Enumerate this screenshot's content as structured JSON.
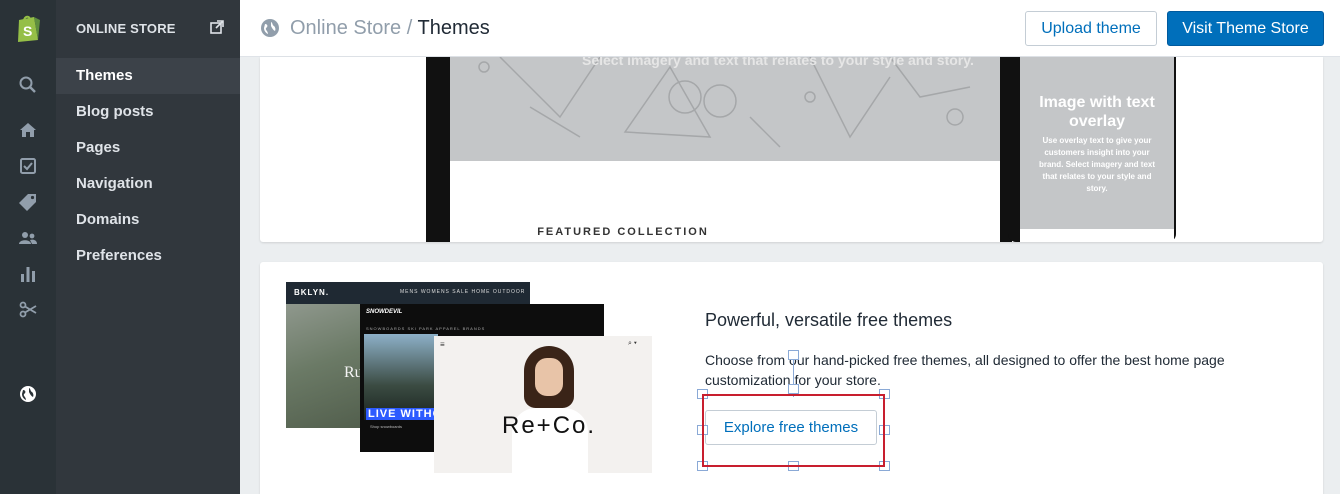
{
  "sidebar": {
    "heading": "ONLINE STORE",
    "items": [
      {
        "label": "Themes",
        "active": true
      },
      {
        "label": "Blog posts",
        "active": false
      },
      {
        "label": "Pages",
        "active": false
      },
      {
        "label": "Navigation",
        "active": false
      },
      {
        "label": "Domains",
        "active": false
      },
      {
        "label": "Preferences",
        "active": false
      }
    ]
  },
  "header": {
    "breadcrumb_parent": "Online Store",
    "breadcrumb_separator": " / ",
    "breadcrumb_current": "Themes",
    "upload_label": "Upload theme",
    "visit_label": "Visit Theme Store"
  },
  "preview": {
    "tagline": "Select imagery and text that relates to your style and story.",
    "featured": "FEATURED COLLECTION",
    "phone_title": "Image with text overlay",
    "phone_body": "Use overlay text to give your customers insight into your brand. Select imagery and text that relates to your style and story."
  },
  "free_themes": {
    "title": "Powerful, versatile free themes",
    "description": "Choose from our hand-picked free themes, all designed to offer the best home page customization for your store.",
    "button_label": "Explore free themes",
    "thumbs": {
      "t1_brand": "BKLYN.",
      "t1_nav": "MENS   WOMENS   SALE   HOME   OUTDOOR",
      "t1_headline": "Ru",
      "t2_brand": "SNOWDEVIL",
      "t2_live": "LIVE WITHOUT",
      "t2_shop": "Shop snowboards",
      "t3_logo": "Re+Co."
    }
  },
  "colors": {
    "accent": "#006fbb",
    "rail": "#2a3237",
    "sidebar": "#31373d",
    "selection": "#c81e2e"
  }
}
